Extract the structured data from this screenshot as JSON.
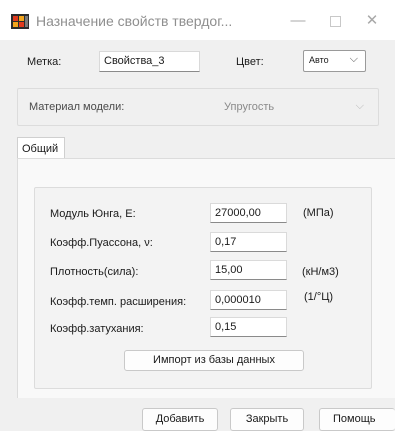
{
  "window": {
    "title": "Назначение свойств твердог...",
    "minimize_glyph": "—",
    "close_glyph": "✕"
  },
  "header": {
    "label_label": "Метка:",
    "label_value": "Свойства_3",
    "color_label": "Цвет:",
    "color_value": "Авто"
  },
  "material": {
    "label": "Материал модели:",
    "value": "Упругость"
  },
  "tabs": [
    {
      "label": "Общий",
      "active": true
    }
  ],
  "properties": [
    {
      "label": "Модуль Юнга, E:",
      "value": "27000,00",
      "unit": "(МПа)"
    },
    {
      "label": "Коэфф.Пуассона, ν:",
      "value": "0,17",
      "unit": ""
    },
    {
      "label": "Плотность(сила):",
      "value": "15,00",
      "unit": "(кН/м3)"
    },
    {
      "label": "Коэфф.темп. расширения:",
      "value": "0,000010",
      "unit": "(1/°Ц)"
    },
    {
      "label": "Коэфф.затухания:",
      "value": "0,15",
      "unit": ""
    }
  ],
  "import_button": "Импорт из базы данных",
  "footer": {
    "add": "Добавить",
    "close": "Закрыть",
    "help": "Помощь"
  },
  "colors": {
    "dialog_bg": "#f0f0f0",
    "title_text": "#8f8f8f",
    "disabled_text": "#8a8a8a"
  },
  "icons": {
    "app": "app-icon",
    "chevron": "chevron-down-icon"
  }
}
